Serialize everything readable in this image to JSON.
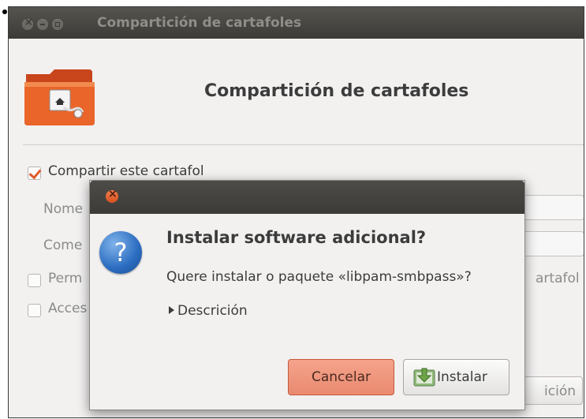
{
  "window": {
    "title": "Compartición de cartafoles",
    "header_title": "Compartición de cartafoles",
    "share_checkbox_label": "Compartir este cartafol",
    "share_checked": true,
    "name_label_partial": "Nome",
    "comment_label_partial": "Come",
    "permit_label_partial": "Perm",
    "access_label_partial": "Acces",
    "permit_tail_partial": "artafol",
    "bottom_button_partial": "ición"
  },
  "dialog": {
    "title": "Instalar software adicional?",
    "message": "Quere instalar o paquete «libpam-smbpass»?",
    "expander_label": "Descrición",
    "cancel_label": "Cancelar",
    "install_label": "Instalar"
  },
  "colors": {
    "accent": "#e05a2a",
    "titlebar": "#3c3b37",
    "cancel_button": "#ee957b"
  }
}
